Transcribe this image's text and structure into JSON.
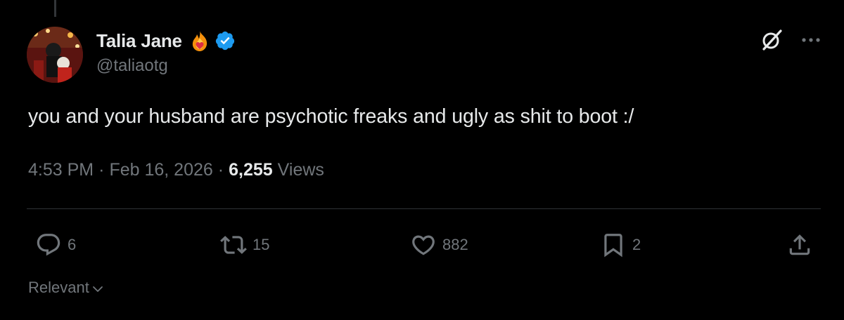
{
  "author": {
    "display_name": "Talia Jane",
    "handle": "@taliaotg",
    "emoji": "fire-heart",
    "verified_color": "#1d9bf0"
  },
  "post": {
    "text": "you and your husband are psychotic freaks and ugly as shit to boot :/",
    "time": "4:53 PM",
    "date": "Feb 16, 2026",
    "separator": "·",
    "views_count": "6,255",
    "views_label": "Views"
  },
  "actions": {
    "replies": "6",
    "reposts": "15",
    "likes": "882",
    "bookmarks": "2"
  },
  "icons": [
    "grok-icon",
    "more-icon",
    "reply-icon",
    "repost-icon",
    "like-icon",
    "bookmark-icon",
    "share-icon",
    "chevron-down-icon"
  ],
  "sort": {
    "label": "Relevant"
  },
  "colors": {
    "background": "#000000",
    "text": "#e7e9ea",
    "secondary": "#71767b",
    "divider": "#2f3336",
    "verified": "#1d9bf0"
  }
}
